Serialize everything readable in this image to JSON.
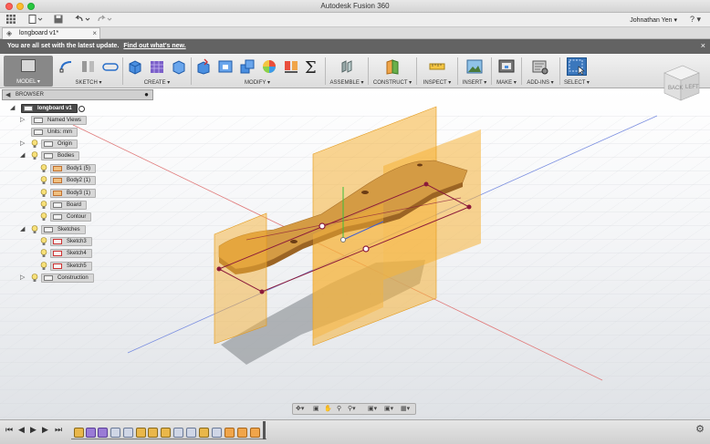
{
  "window": {
    "title": "Autodesk Fusion 360"
  },
  "quickbar": {
    "user": "Johnathan Yen ▾",
    "help": "? ▾"
  },
  "tab": {
    "label": "longboard v1*",
    "close": "×"
  },
  "notification": {
    "text": "You are all set with the latest update.",
    "link": "Find out what's new.",
    "close": "×"
  },
  "toolbar": {
    "model": "MODEL ▾",
    "groups": [
      "SKETCH ▾",
      "CREATE ▾",
      "MODIFY ▾",
      "ASSEMBLE ▾",
      "CONSTRUCT ▾",
      "INSPECT ▾",
      "INSERT ▾",
      "MAKE ▾",
      "ADD-INS ▾",
      "SELECT ▾"
    ]
  },
  "browser": {
    "title": "BROWSER",
    "items": [
      {
        "label": "longboard v1"
      },
      {
        "label": "Named Views"
      },
      {
        "label": "Units: mm"
      },
      {
        "label": "Origin"
      },
      {
        "label": "Bodies"
      },
      {
        "label": "Body1 (5)"
      },
      {
        "label": "Body2 (1)"
      },
      {
        "label": "Body3 (1)"
      },
      {
        "label": "Board"
      },
      {
        "label": "Contour"
      },
      {
        "label": "Sketches"
      },
      {
        "label": "Sketch3"
      },
      {
        "label": "Sketch4"
      },
      {
        "label": "Sketch5"
      },
      {
        "label": "Construction"
      }
    ]
  },
  "viewcube": {
    "back": "BACK",
    "left": "LEFT"
  },
  "colors": {
    "accent": "#f5a623",
    "sketch": "#8b1a3a",
    "notification": "#636363"
  }
}
